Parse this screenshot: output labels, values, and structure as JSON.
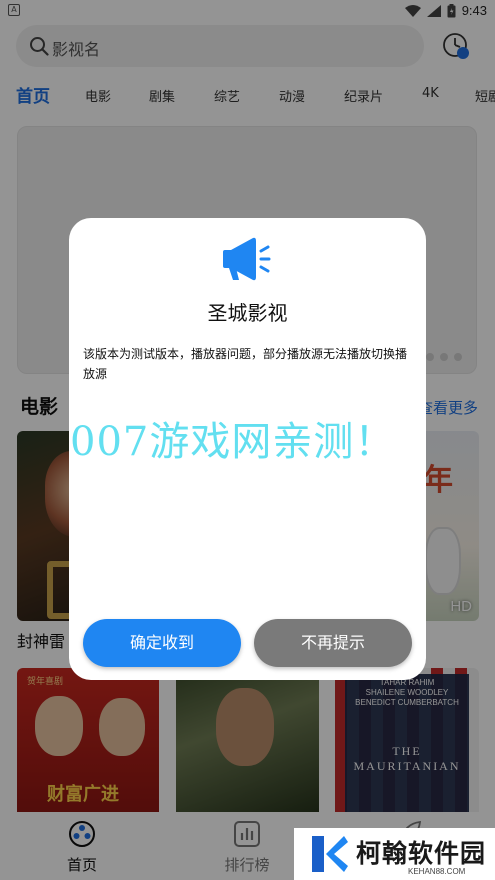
{
  "status_bar": {
    "notification": "A",
    "time": "9:43"
  },
  "search": {
    "placeholder": "影视名"
  },
  "tabs": [
    {
      "label": "首页",
      "active": true
    },
    {
      "label": "电影"
    },
    {
      "label": "剧集"
    },
    {
      "label": "综艺"
    },
    {
      "label": "动漫"
    },
    {
      "label": "纪录片"
    },
    {
      "label": "4K"
    },
    {
      "label": "短剧"
    }
  ],
  "section": {
    "title": "电影",
    "more": "查看更多"
  },
  "movies": [
    {
      "caption": "封神雷",
      "badge": "",
      "title_text": ""
    },
    {
      "caption": "",
      "badge": "HD",
      "title_text": "年"
    }
  ],
  "row2": {
    "poster1_top": "贺年喜剧",
    "poster1_title": "财富广进",
    "poster3_names": "TAHAR RAHIM\nSHAILENE WOODLEY\nBENEDICT CUMBERBATCH",
    "poster3_title": "THE MAURITANIAN"
  },
  "bottom_nav": [
    {
      "label": "首页",
      "icon": "film-reel-icon",
      "active": true
    },
    {
      "label": "排行榜",
      "icon": "bar-chart-icon",
      "active": false
    },
    {
      "label": "",
      "icon": "leaf-icon",
      "active": false
    }
  ],
  "dialog": {
    "icon": "megaphone-icon",
    "title": "圣城影视",
    "body": "该版本为测试版本，播放器问题，部分播放源无法播放切换播放源",
    "confirm_label": "确定收到",
    "dismiss_label": "不再提示"
  },
  "watermark": {
    "text": "007游戏网亲测！",
    "brand_name": "柯翰软件园",
    "brand_url": "KEHAN88.COM"
  },
  "colors": {
    "accent": "#1f6fe0",
    "confirm": "#1f86f2",
    "dismiss": "#7a7a7a",
    "watermark": "#62dff0"
  }
}
